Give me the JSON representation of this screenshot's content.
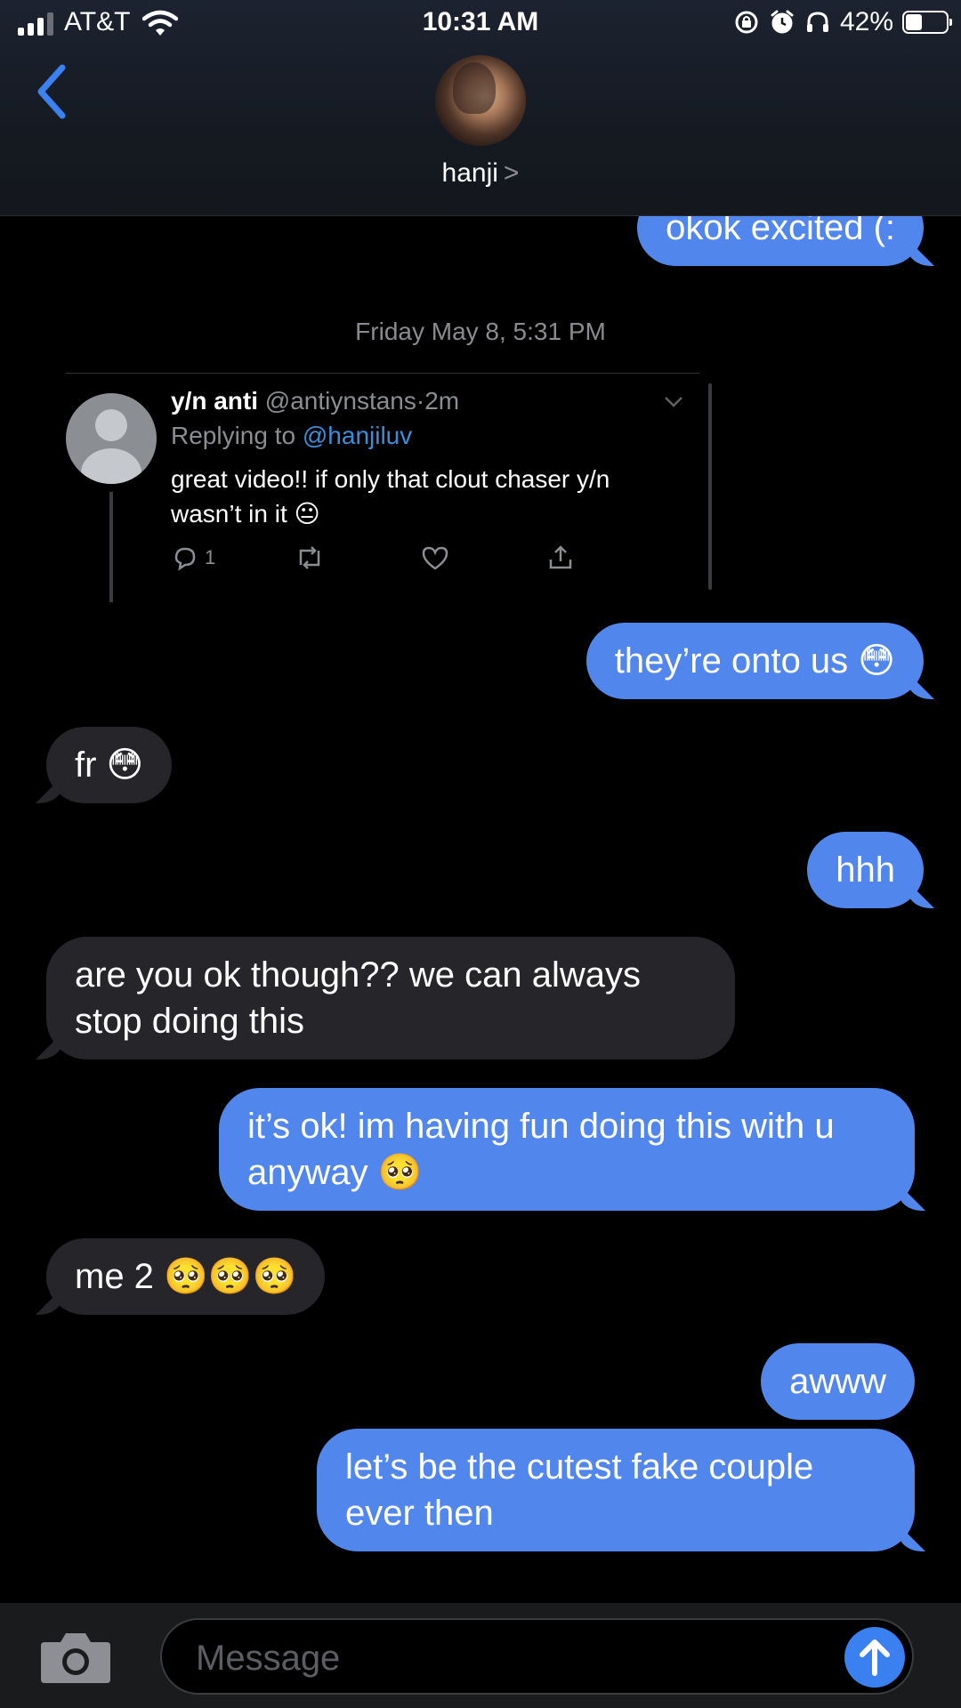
{
  "status_bar": {
    "carrier": "AT&T",
    "time": "10:31 AM",
    "battery": "42%",
    "battery_level": 0.42,
    "icons": [
      "signal-icon",
      "wifi-icon",
      "rotation-lock-icon",
      "alarm-icon",
      "headphones-icon",
      "battery-icon"
    ]
  },
  "header": {
    "back_icon": "chevron-left-icon",
    "contact_name": "hanji",
    "contact_chevron": ">"
  },
  "messages": {
    "m0": "okok excited (:",
    "timestamp": "Friday May 8, 5:31 PM",
    "m1": "they’re onto us 😳",
    "m2": "fr 😳",
    "m3": "hhh",
    "m4": "are you ok though?? we can always stop doing this",
    "m5": "it’s ok! im having fun doing this with u anyway 🥺",
    "m6": "me 2 🥺🥺🥺",
    "m7": "awww",
    "m8": "let’s be the cutest fake couple ever then"
  },
  "tweet": {
    "name": "y/n anti",
    "handle": "@antiynstans",
    "separator": "·",
    "age": "2m",
    "replying_prefix": "Replying to ",
    "replying_to": "@hanjiluv",
    "text": "great video!! if only that clout chaser y/n wasn’t in it 😐",
    "reply_count": "1"
  },
  "composer": {
    "placeholder": "Message",
    "camera_icon": "camera-icon",
    "send_icon": "arrow-up-icon"
  },
  "colors": {
    "sent_bubble": "#5186ec",
    "received_bubble": "#26262a",
    "accent": "#3b80f0"
  }
}
